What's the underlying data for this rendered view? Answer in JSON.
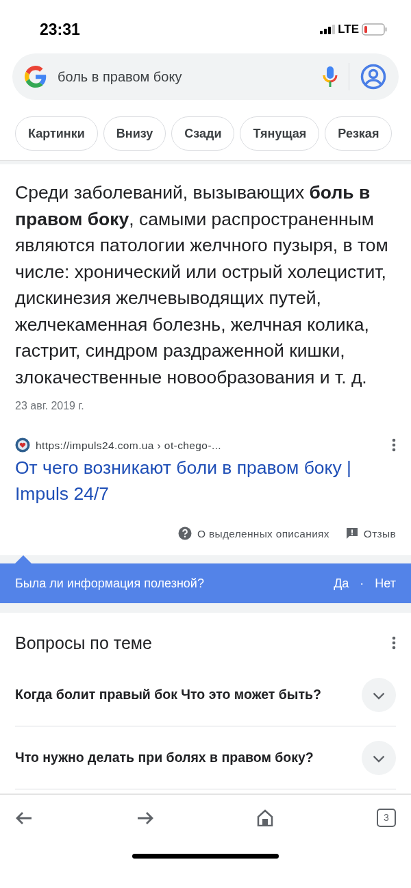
{
  "status_bar": {
    "time": "23:31",
    "network": "LTE"
  },
  "search": {
    "query": "боль в правом боку"
  },
  "chips": [
    {
      "label": "Картинки"
    },
    {
      "label": "Внизу"
    },
    {
      "label": "Сзади"
    },
    {
      "label": "Тянущая"
    },
    {
      "label": "Резкая"
    }
  ],
  "snippet": {
    "text": "Среди заболеваний, вызывающих **боль в правом боку**, самыми распространенным являются патологии желчного пузыря, в том числе: хронический или острый холецистит, дискинезия желчевыводящих путей, желчекаменная болезнь, желчная колика, гастрит, синдром раздраженной кишки, злокачественные новообразования и т. д.",
    "date": "23 авг. 2019 г."
  },
  "source": {
    "url": "https://impuls24.com.ua › ot-chego-...",
    "title": "От чего возникают боли в правом боку | Impuls 24/7"
  },
  "footer_links": [
    "О выделенных описаниях",
    "Отзыв"
  ],
  "feedback": {
    "question": "Была ли информация полезной?",
    "yes": "Да",
    "separator": "·",
    "no": "Нет"
  },
  "related": {
    "title": "Вопросы по теме",
    "questions": [
      {
        "text": "Когда болит правый бок Что это может быть?",
        "expanded": false
      },
      {
        "text": "Что нужно делать при болях в правом боку?",
        "expanded": false
      }
    ]
  },
  "bottom_bar": {
    "tab_count": "3"
  }
}
